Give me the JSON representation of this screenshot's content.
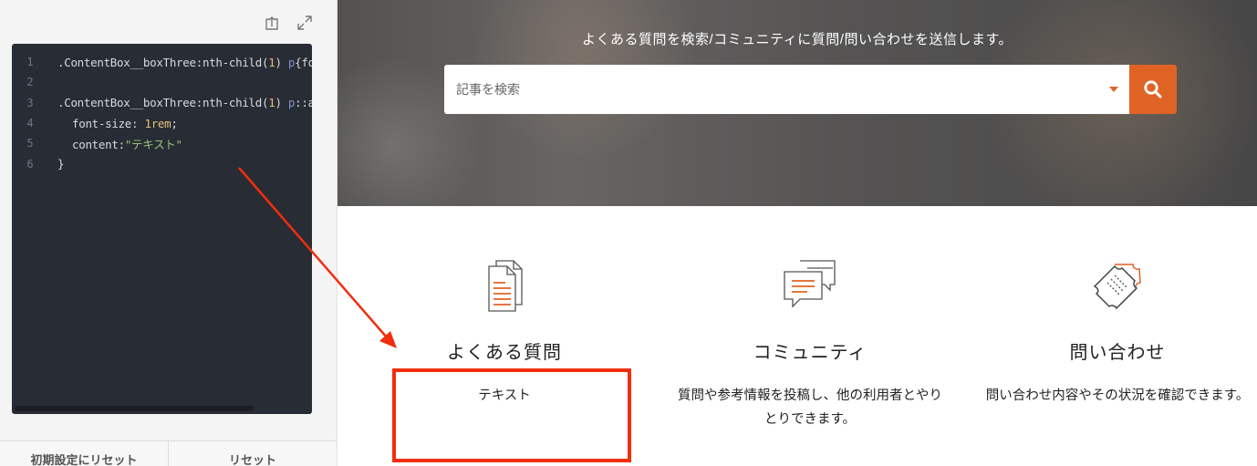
{
  "editor": {
    "toolbar": {
      "upload_icon": "upload-icon",
      "expand_icon": "expand-icon"
    },
    "lines": [
      {
        "num": "1",
        "segments": [
          {
            "text": ".ContentBox__boxThree:nth-child(",
            "type": "plain"
          },
          {
            "text": "1",
            "type": "num"
          },
          {
            "text": ") ",
            "type": "plain"
          },
          {
            "text": "p",
            "type": "p"
          },
          {
            "text": "{font",
            "type": "plain"
          }
        ]
      },
      {
        "num": "2",
        "segments": []
      },
      {
        "num": "3",
        "segments": [
          {
            "text": ".ContentBox__boxThree:nth-child(",
            "type": "plain"
          },
          {
            "text": "1",
            "type": "num"
          },
          {
            "text": ") ",
            "type": "plain"
          },
          {
            "text": "p",
            "type": "p"
          },
          {
            "text": "::afte",
            "type": "plain"
          }
        ]
      },
      {
        "num": "4",
        "indent": true,
        "segments": [
          {
            "text": "font-size: ",
            "type": "plain"
          },
          {
            "text": "1rem",
            "type": "num"
          },
          {
            "text": ";",
            "type": "plain"
          }
        ]
      },
      {
        "num": "5",
        "indent": true,
        "segments": [
          {
            "text": "content:",
            "type": "plain"
          },
          {
            "text": "\"テキスト\"",
            "type": "str"
          }
        ]
      },
      {
        "num": "6",
        "segments": [
          {
            "text": "}",
            "type": "plain"
          }
        ]
      }
    ],
    "reset_default_label": "初期設定にリセット",
    "reset_label": "リセット"
  },
  "preview": {
    "hero_title": "よくある質問を検索/コミュニティに質問/問い合わせを送信します。",
    "search": {
      "placeholder": "記事を検索"
    },
    "cards": [
      {
        "icon": "document-icon",
        "title": "よくある質問",
        "text": "テキスト"
      },
      {
        "icon": "chat-bubbles-icon",
        "title": "コミュニティ",
        "text": "質問や参考情報を投稿し、他の利用者とやりとりできます。"
      },
      {
        "icon": "ticket-icon",
        "title": "問い合わせ",
        "text": "問い合わせ内容やその状況を確認できます。"
      }
    ]
  },
  "colors": {
    "accent": "#e06326",
    "annotation": "#f22d0f",
    "editor_bg": "#282c34"
  }
}
